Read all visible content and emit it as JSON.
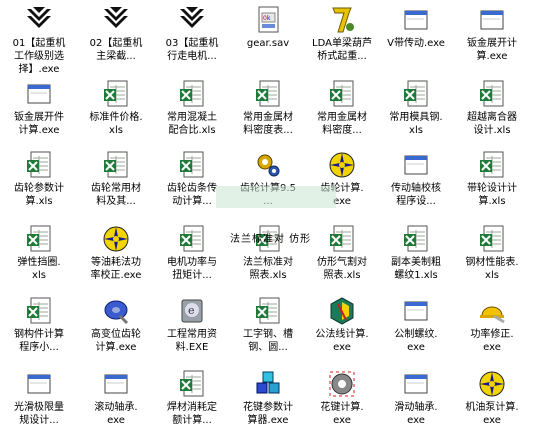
{
  "files": [
    {
      "label": "01【起重机\n工作级别选\n择】.exe",
      "icon": "crane-logo-icon"
    },
    {
      "label": "02【起重机\n主梁截...",
      "icon": "crane-logo-icon"
    },
    {
      "label": "03【起重机\n行走电机...",
      "icon": "crane-logo-icon"
    },
    {
      "label": "gear.sav",
      "icon": "sav-file-icon"
    },
    {
      "label": "LDA单梁葫芦\n桥式起重...",
      "icon": "figure7-icon"
    },
    {
      "label": "V带传动.exe",
      "icon": "exe-window-icon"
    },
    {
      "label": "钣金展开计\n算.exe",
      "icon": "exe-window-icon"
    },
    {
      "label": "钣金展开件\n计算.exe",
      "icon": "exe-window-icon"
    },
    {
      "label": "标准件价格.\nxls",
      "icon": "excel-icon"
    },
    {
      "label": "常用混凝土\n配合比.xls",
      "icon": "excel-icon"
    },
    {
      "label": "常用金属材\n料密度表...",
      "icon": "excel-icon"
    },
    {
      "label": "常用金属材\n料密度...",
      "icon": "excel-icon"
    },
    {
      "label": "常用模具钢.\nxls",
      "icon": "excel-icon"
    },
    {
      "label": "超越离合器\n设计.xls",
      "icon": "excel-icon"
    },
    {
      "label": "齿轮参数计\n算.xls",
      "icon": "excel-icon"
    },
    {
      "label": "齿轮常用材\n料及其...",
      "icon": "excel-icon"
    },
    {
      "label": "齿轮齿条传\n动计算...",
      "icon": "excel-icon"
    },
    {
      "label": "齿轮计算9.5\n...",
      "icon": "gear-program-icon"
    },
    {
      "label": "齿轮计算.\nexe",
      "icon": "starburst-icon"
    },
    {
      "label": "传动轴校核\n程序设...",
      "icon": "exe-window-icon"
    },
    {
      "label": "带轮设计计\n算.xls",
      "icon": "excel-icon"
    },
    {
      "label": "弹性挡圈.\nxls",
      "icon": "excel-icon"
    },
    {
      "label": "等油耗法功\n率校正.exe",
      "icon": "starburst-icon"
    },
    {
      "label": "电机功率与\n扭矩计...",
      "icon": "excel-icon"
    },
    {
      "label": "法兰标准对\n照表.xls",
      "icon": "excel-icon"
    },
    {
      "label": "仿形气割对\n照表.xls",
      "icon": "excel-icon"
    },
    {
      "label": "副本美制粗\n螺纹1.xls",
      "icon": "excel-icon"
    },
    {
      "label": "钢材性能表.\nxls",
      "icon": "excel-icon"
    },
    {
      "label": "钢构件计算\n程序小...",
      "icon": "excel-icon"
    },
    {
      "label": "高变位齿轮\n计算.exe",
      "icon": "disc-icon"
    },
    {
      "label": "工程常用资\n料.EXE",
      "icon": "book-e-icon"
    },
    {
      "label": "工字钢、槽\n钢、圆...",
      "icon": "excel-icon"
    },
    {
      "label": "公法线计算.\nexe",
      "icon": "hexagon-icon"
    },
    {
      "label": "公制螺纹.\nexe",
      "icon": "exe-window-icon"
    },
    {
      "label": "功率修正.\nexe",
      "icon": "hardhat-icon"
    },
    {
      "label": "光滑极限量\n规设计...",
      "icon": "exe-window-icon"
    },
    {
      "label": "滚动轴承.\nexe",
      "icon": "exe-window-icon"
    },
    {
      "label": "焊材消耗定\n额计算...",
      "icon": "excel-icon"
    },
    {
      "label": "花键参数计\n算器.exe",
      "icon": "cubes-icon"
    },
    {
      "label": "花键计算.\nexe",
      "icon": "gear-red-icon"
    },
    {
      "label": "滑动轴承.\nexe",
      "icon": "exe-window-icon"
    },
    {
      "label": "机油泵计算.\nexe",
      "icon": "starburst-icon"
    }
  ],
  "drag_ghost": {
    "label": "法兰标准对  仿形"
  }
}
